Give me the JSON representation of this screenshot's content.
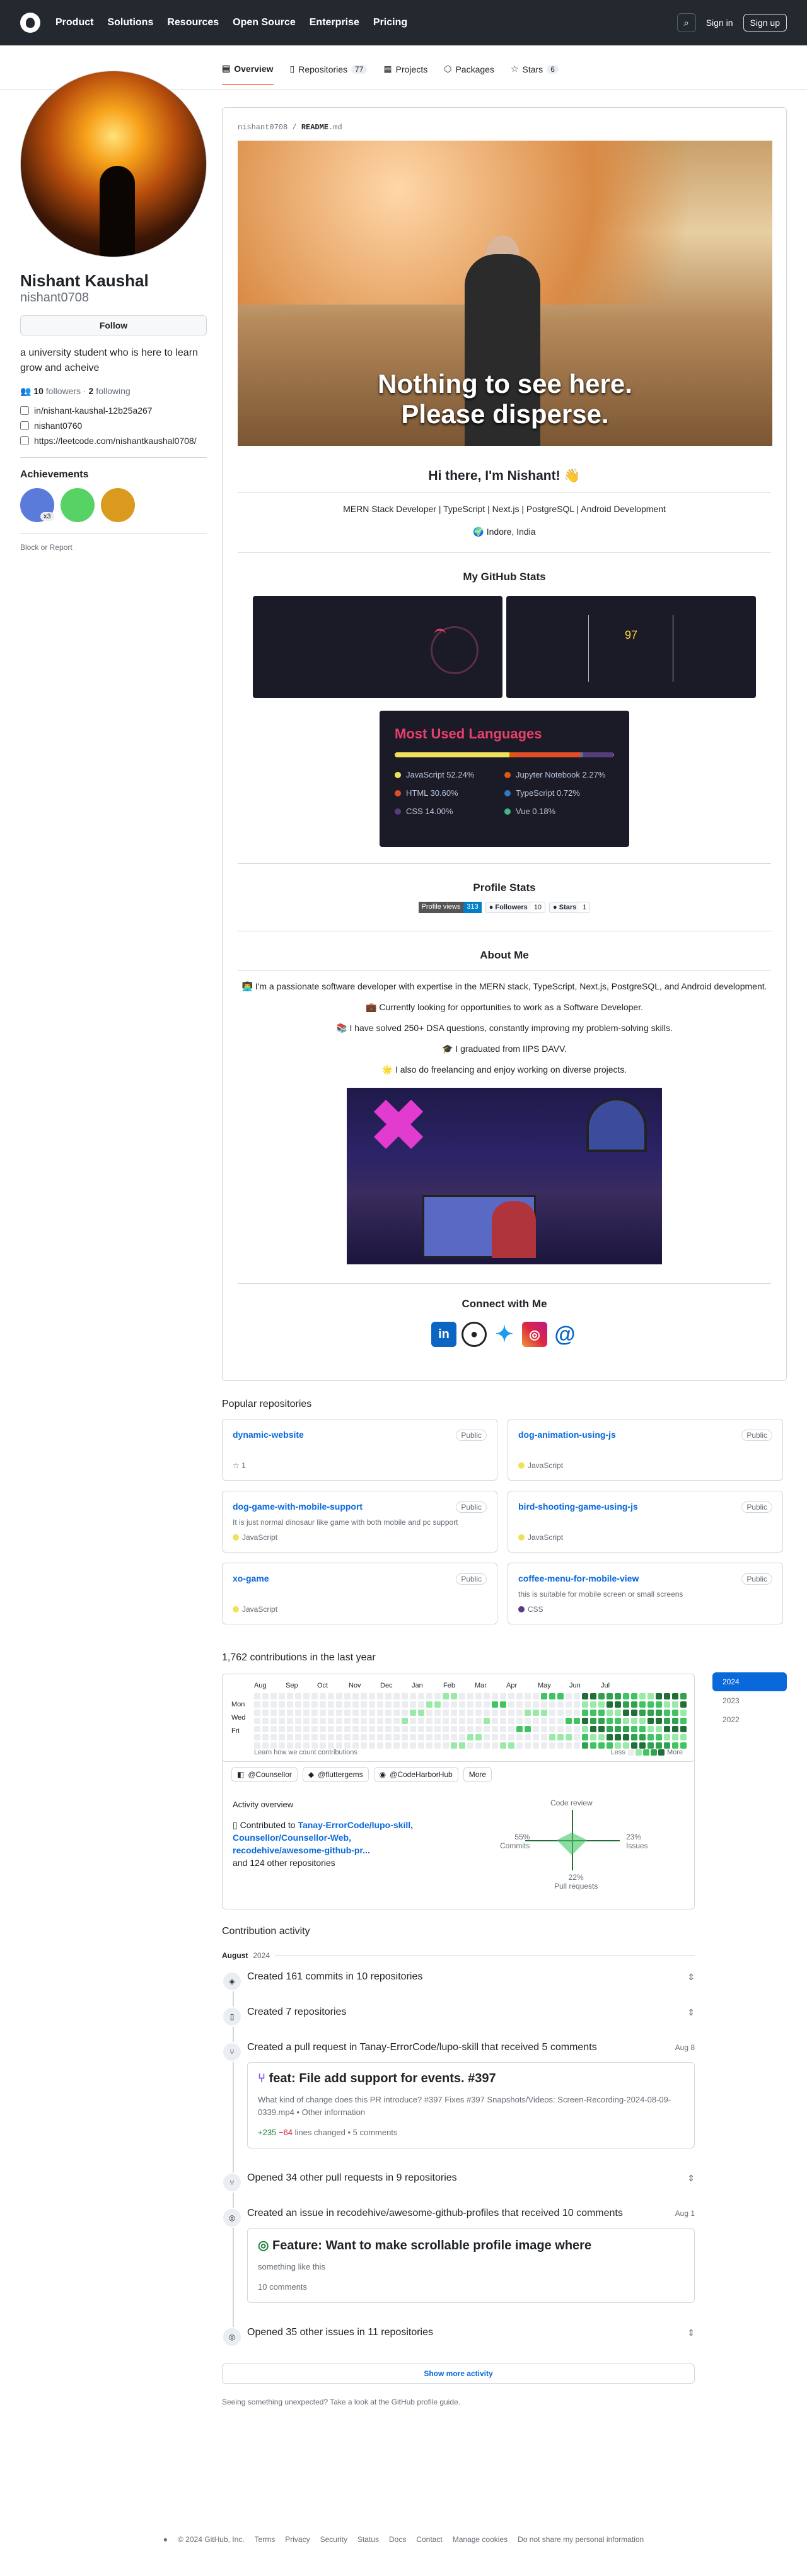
{
  "nav": {
    "items": [
      "Product",
      "Solutions",
      "Resources",
      "Open Source",
      "Enterprise",
      "Pricing"
    ],
    "search_icon": "search-icon",
    "signin": "Sign in",
    "signup": "Sign up"
  },
  "tabs": [
    {
      "label": "Overview",
      "count": ""
    },
    {
      "label": "Repositories",
      "count": "77"
    },
    {
      "label": "Projects",
      "count": ""
    },
    {
      "label": "Packages",
      "count": ""
    },
    {
      "label": "Stars",
      "count": "6"
    }
  ],
  "profile": {
    "name": "Nishant Kaushal",
    "login": "nishant0708",
    "follow": "Follow",
    "bio": "a university student who is here to learn grow and acheive",
    "followers": "10",
    "followers_label": "followers",
    "following": "2",
    "following_label": "following",
    "linkedin": "in/nishant-kaushal-12b25a267",
    "x": "nishant0760",
    "website": "https://leetcode.com/nishantkaushal0708/",
    "achievements": "Achievements",
    "badge_count": "x3",
    "block": "Block or Report"
  },
  "readme": {
    "path_user": "nishant0708",
    "path_file": "README",
    "path_ext": ".md",
    "gif_caption_1": "Nothing to see here.",
    "gif_caption_2": "Please disperse.",
    "greeting": "Hi there, I'm Nishant! 👋",
    "stack": "MERN Stack Developer | TypeScript | Next.js | PostgreSQL | Android Development",
    "location": "🌍 Indore, India",
    "stats_title": "My GitHub Stats",
    "streak": "97",
    "langs_title": "Most Used Languages",
    "langs": [
      {
        "name": "JavaScript",
        "pct": "52.24%",
        "color": "#f1e05a"
      },
      {
        "name": "Jupyter Notebook",
        "pct": "2.27%",
        "color": "#da5b0b"
      },
      {
        "name": "HTML",
        "pct": "30.60%",
        "color": "#e34c26"
      },
      {
        "name": "TypeScript",
        "pct": "0.72%",
        "color": "#3178c6"
      },
      {
        "name": "CSS",
        "pct": "14.00%",
        "color": "#563d7c"
      },
      {
        "name": "Vue",
        "pct": "0.18%",
        "color": "#41b883"
      }
    ],
    "profile_stats": "Profile Stats",
    "pv_label": "Profile views",
    "pv_value": "313",
    "gh_followers": "Followers",
    "gh_followers_val": "10",
    "gh_stars": "Stars",
    "gh_stars_val": "1",
    "about": "About Me",
    "about_lines": [
      "👨‍💻 I'm a passionate software developer with expertise in the MERN stack, TypeScript, Next.js, PostgreSQL, and Android development.",
      "💼 Currently looking for opportunities to work as a Software Developer.",
      "📚 I have solved 250+ DSA questions, constantly improving my problem-solving skills.",
      "🎓 I graduated from IIPS DAVV.",
      "🌟 I also do freelancing and enjoy working on diverse projects."
    ],
    "connect": "Connect with Me"
  },
  "popular": {
    "title": "Popular repositories",
    "repos": [
      {
        "name": "dynamic-website",
        "vis": "Public",
        "desc": "",
        "lang": "",
        "lang_color": "",
        "stars": "1"
      },
      {
        "name": "dog-animation-using-js",
        "vis": "Public",
        "desc": "",
        "lang": "JavaScript",
        "lang_color": "#f1e05a",
        "stars": ""
      },
      {
        "name": "dog-game-with-mobile-support",
        "vis": "Public",
        "desc": "It is just normal dinosaur like game with both mobile and pc support",
        "lang": "JavaScript",
        "lang_color": "#f1e05a",
        "stars": ""
      },
      {
        "name": "bird-shooting-game-using-js",
        "vis": "Public",
        "desc": "",
        "lang": "JavaScript",
        "lang_color": "#f1e05a",
        "stars": ""
      },
      {
        "name": "xo-game",
        "vis": "Public",
        "desc": "",
        "lang": "JavaScript",
        "lang_color": "#f1e05a",
        "stars": ""
      },
      {
        "name": "coffee-menu-for-mobile-view",
        "vis": "Public",
        "desc": "this is suitable for mobile screen or small screens",
        "lang": "CSS",
        "lang_color": "#563d7c",
        "stars": ""
      }
    ]
  },
  "contributions": {
    "title": "1,762 contributions in the last year",
    "months": [
      "Aug",
      "Sep",
      "Oct",
      "Nov",
      "Dec",
      "Jan",
      "Feb",
      "Mar",
      "Apr",
      "May",
      "Jun",
      "Jul"
    ],
    "days": [
      "Mon",
      "Wed",
      "Fri"
    ],
    "learn": "Learn how we count contributions",
    "less": "Less",
    "more": "More",
    "years": [
      "2024",
      "2023",
      "2022"
    ],
    "orgs": [
      "@Counsellor",
      "@fluttergems",
      "@CodeHarborHub"
    ],
    "orgs_more": "More",
    "overview": "Activity overview",
    "contributed": "Contributed to",
    "contrib_repos": "Tanay-ErrorCode/lupo-skill, Counsellor/Counsellor-Web, recodehive/awesome-github-pr...",
    "contrib_other": "and 124 other repositories",
    "code_review": "Code review",
    "commits_pct": "55%",
    "commits": "Commits",
    "issues_pct": "23%",
    "issues": "Issues",
    "pr_pct": "22%",
    "prs": "Pull requests"
  },
  "activity": {
    "title": "Contribution activity",
    "month": "August",
    "year": "2024",
    "items": [
      "Created 161 commits in 10 repositories",
      "Created 7 repositories",
      "Created a pull request in Tanay-ErrorCode/lupo-skill that received 5 comments",
      "Opened 34 other pull requests in 9 repositories",
      "Created an issue in recodehive/awesome-github-profiles that received 10 comments",
      "Opened 35 other issues in 11 repositories"
    ],
    "pr_date": "Aug 8",
    "pr_title": "feat: File add support for events. #397",
    "pr_body": "What kind of change does this PR introduce? #397 Fixes #397 Snapshots/Videos: Screen-Recording-2024-08-09-0339.mp4 • Other information",
    "pr_add": "+235",
    "pr_del": "−64",
    "pr_lines": "lines changed • 5 comments",
    "issue_date": "Aug 1",
    "issue_title": "Feature: Want to make scrollable profile image where",
    "issue_body": "something like this",
    "issue_comments": "10 comments",
    "show_more": "Show more activity",
    "unexpected": "Seeing something unexpected? Take a look at the GitHub profile guide."
  },
  "footer": [
    "© 2024 GitHub, Inc.",
    "Terms",
    "Privacy",
    "Security",
    "Status",
    "Docs",
    "Contact",
    "Manage cookies",
    "Do not share my personal information"
  ]
}
